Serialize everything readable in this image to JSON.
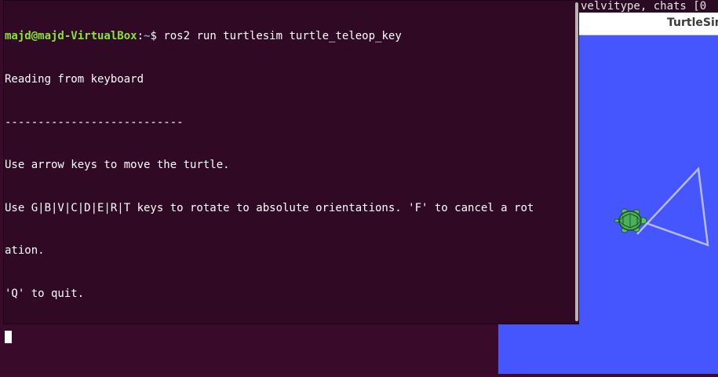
{
  "background_terminal": {
    "visible_text": "velvitype, chats [0"
  },
  "turtlesim": {
    "title": "TurtleSim",
    "background_color": "#4556ff",
    "trail_color": "#b6bbff"
  },
  "terminal": {
    "prompt_user": "majd@majd-VirtualBox",
    "prompt_sep": ":",
    "prompt_path": "~",
    "prompt_symbol": "$ ",
    "command": "ros2 run turtlesim turtle_teleop_key",
    "output_lines": [
      "Reading from keyboard",
      "---------------------------",
      "Use arrow keys to move the turtle.",
      "Use G|B|V|C|D|E|R|T keys to rotate to absolute orientations. 'F' to cancel a rot",
      "ation.",
      "'Q' to quit."
    ],
    "background_color": "#300a24"
  }
}
